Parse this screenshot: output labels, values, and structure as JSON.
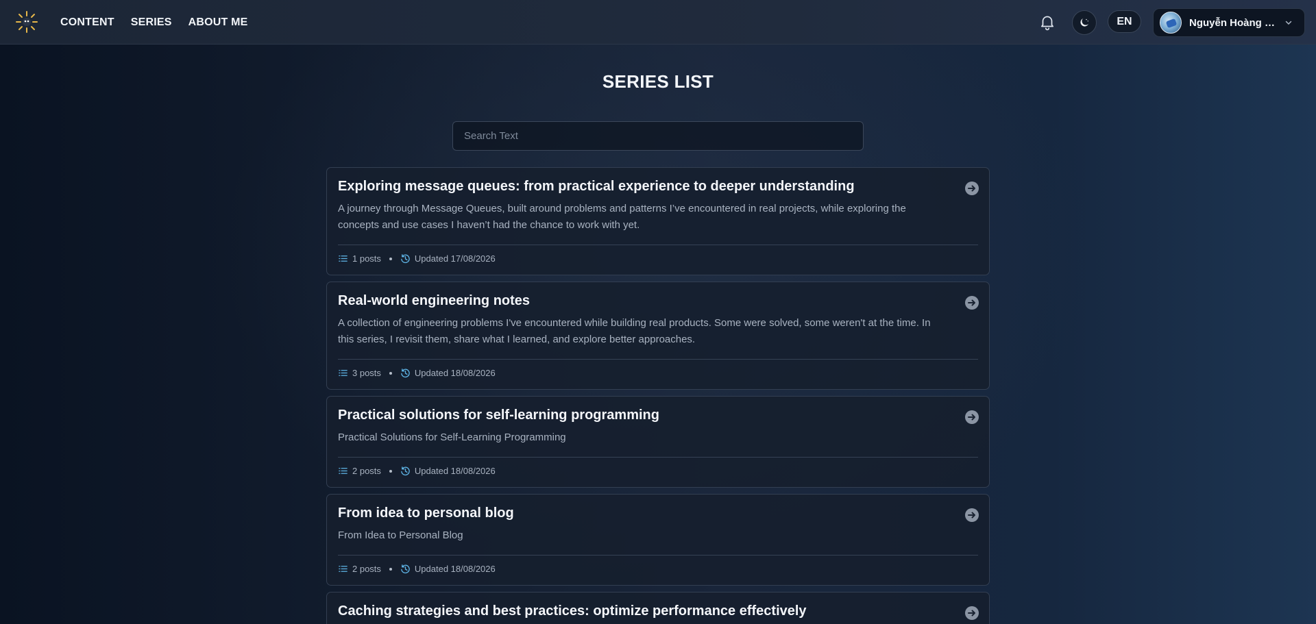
{
  "nav": {
    "links": [
      "CONTENT",
      "SERIES",
      "ABOUT ME"
    ],
    "language": "EN",
    "user_name": "Nguyễn Hoàng L..."
  },
  "page": {
    "title": "SERIES LIST",
    "search_placeholder": "Search Text"
  },
  "series": [
    {
      "title": "Exploring message queues: from practical experience to deeper understanding",
      "description": "A journey through Message Queues, built around problems and patterns I’ve encountered in real projects, while exploring the concepts and use cases I haven’t had the chance to work with yet.",
      "posts": "1 posts",
      "updated": "Updated 17/08/2026"
    },
    {
      "title": "Real-world engineering notes",
      "description": "A collection of engineering problems I've encountered while building real products. Some were solved, some weren't at the time. In this series, I revisit them, share what I learned, and explore better approaches.",
      "posts": "3 posts",
      "updated": "Updated 18/08/2026"
    },
    {
      "title": "Practical solutions for self-learning programming",
      "description": "Practical Solutions for Self-Learning Programming",
      "posts": "2 posts",
      "updated": "Updated 18/08/2026"
    },
    {
      "title": "From idea to personal blog",
      "description": "From Idea to Personal Blog",
      "posts": "2 posts",
      "updated": "Updated 18/08/2026"
    },
    {
      "title": "Caching strategies and best practices: optimize performance effectively",
      "description": "",
      "posts": "",
      "updated": ""
    }
  ],
  "colors": {
    "accent_icon": "#5fb6e8",
    "card_bg": "#161f2e",
    "header_bg": "#1f2a3b"
  }
}
